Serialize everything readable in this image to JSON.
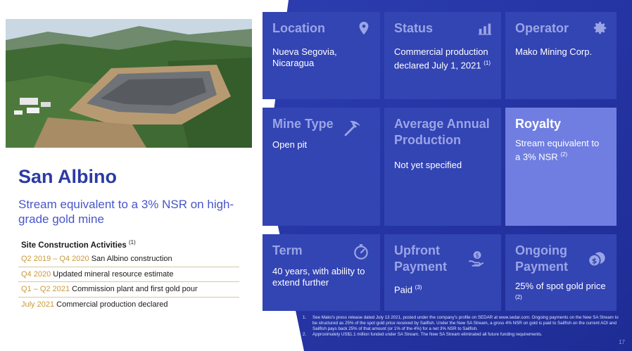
{
  "mine": {
    "name": "San Albino",
    "subtitle": "Stream equivalent to a 3% NSR on high-grade gold mine"
  },
  "activities": {
    "heading": "Site Construction Activities",
    "heading_note": "(1)",
    "items": [
      {
        "date": "Q2 2019 – Q4 2020",
        "text": "San Albino construction"
      },
      {
        "date": "Q4 2020",
        "text": "Updated mineral resource estimate"
      },
      {
        "date": "Q1 – Q2 2021",
        "text": "Commission plant and first gold pour"
      },
      {
        "date": "July 2021",
        "text": "Commercial production declared"
      }
    ]
  },
  "tiles": {
    "location": {
      "title": "Location",
      "value": "Nueva Segovia, Nicaragua",
      "icon": "location-pin-icon"
    },
    "status": {
      "title": "Status",
      "value": "Commercial production declared July 1, 2021",
      "note": "(1)",
      "icon": "bar-chart-icon"
    },
    "operator": {
      "title": "Operator",
      "value": "Mako Mining Corp.",
      "icon": "gear-icon"
    },
    "mine_type": {
      "title": "Mine Type",
      "value": "Open pit",
      "icon": "pickaxe-icon"
    },
    "production": {
      "title": "Average Annual Production",
      "value": "Not yet specified"
    },
    "royalty": {
      "title": "Royalty",
      "value": "Stream equivalent to a 3% NSR",
      "note": "(2)"
    },
    "term": {
      "title": "Term",
      "value": "40 years, with ability to extend further",
      "icon": "stopwatch-icon"
    },
    "upfront": {
      "title": "Upfront Payment",
      "value": "Paid",
      "note": "(3)",
      "icon": "hand-dollar-icon"
    },
    "ongoing": {
      "title": "Ongoing Payment",
      "value": "25% of spot gold price",
      "note": "(2)",
      "icon": "coins-icon"
    }
  },
  "footnotes": [
    {
      "n": "1.",
      "text": "See Mako's press release dated July 13 2021, posted under the company's profile on SEDAR at www.sedar.com. Ongoing payments on the New SA Stream to be structured as 25% of the spot gold price received by Sailfish. Under the New SA Stream, a gross 4% NSR on gold is paid to Sailfish on the current AOI and Sailfish pays back 25% of that amount (or 1% of the 4%) for a net 3% NSR to Sailfish."
    },
    {
      "n": "2.",
      "text": "Approximately US$1.1 million funded under SA Stream. The New SA Stream eliminated all future funding requirements."
    }
  ],
  "page_number": "17",
  "colors": {
    "tile": "#3344b3",
    "tile_highlight": "#6f7ee0",
    "background": "#2433a0",
    "title": "#2b3aa6",
    "accent_gold": "#c89a3a"
  }
}
